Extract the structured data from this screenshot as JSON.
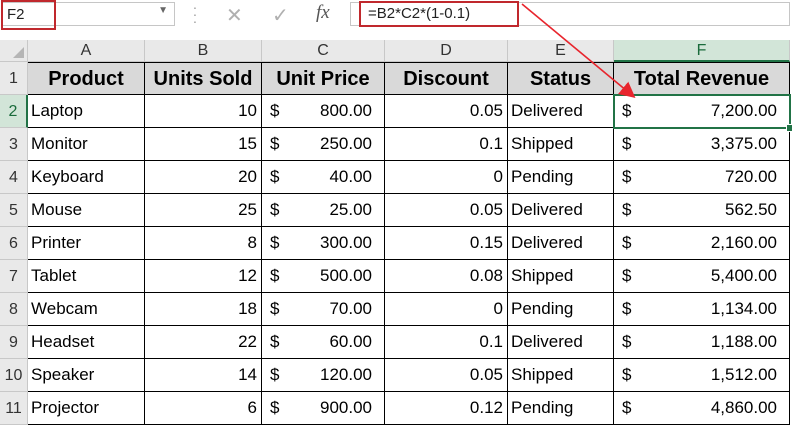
{
  "name_box": {
    "value": "F2"
  },
  "formula_bar": {
    "formula": "=B2*C2*(1-0.1)",
    "fx_label": "fx",
    "cancel_glyph": "✕",
    "enter_glyph": "✓"
  },
  "columns": [
    "A",
    "B",
    "C",
    "D",
    "E",
    "F"
  ],
  "rows": [
    "1",
    "2",
    "3",
    "4",
    "5",
    "6",
    "7",
    "8",
    "9",
    "10",
    "11"
  ],
  "headers": [
    "Product",
    "Units Sold",
    "Unit Price",
    "Discount",
    "Status",
    "Total Revenue"
  ],
  "currency_symbol": "$",
  "data": [
    {
      "product": "Laptop",
      "units": "10",
      "price": "800.00",
      "discount": "0.05",
      "status": "Delivered",
      "revenue": "7,200.00"
    },
    {
      "product": "Monitor",
      "units": "15",
      "price": "250.00",
      "discount": "0.1",
      "status": "Shipped",
      "revenue": "3,375.00"
    },
    {
      "product": "Keyboard",
      "units": "20",
      "price": "40.00",
      "discount": "0",
      "status": "Pending",
      "revenue": "720.00"
    },
    {
      "product": "Mouse",
      "units": "25",
      "price": "25.00",
      "discount": "0.05",
      "status": "Delivered",
      "revenue": "562.50"
    },
    {
      "product": "Printer",
      "units": "8",
      "price": "300.00",
      "discount": "0.15",
      "status": "Delivered",
      "revenue": "2,160.00"
    },
    {
      "product": "Tablet",
      "units": "12",
      "price": "500.00",
      "discount": "0.08",
      "status": "Shipped",
      "revenue": "5,400.00"
    },
    {
      "product": "Webcam",
      "units": "18",
      "price": "70.00",
      "discount": "0",
      "status": "Pending",
      "revenue": "1,134.00"
    },
    {
      "product": "Headset",
      "units": "22",
      "price": "60.00",
      "discount": "0.1",
      "status": "Delivered",
      "revenue": "1,188.00"
    },
    {
      "product": "Speaker",
      "units": "14",
      "price": "120.00",
      "discount": "0.05",
      "status": "Shipped",
      "revenue": "1,512.00"
    },
    {
      "product": "Projector",
      "units": "6",
      "price": "900.00",
      "discount": "0.12",
      "status": "Pending",
      "revenue": "4,860.00"
    }
  ],
  "selected_cell": "F2",
  "colors": {
    "selection": "#217346",
    "annotation": "#c0282d",
    "header_fill": "#d9d9d9"
  }
}
